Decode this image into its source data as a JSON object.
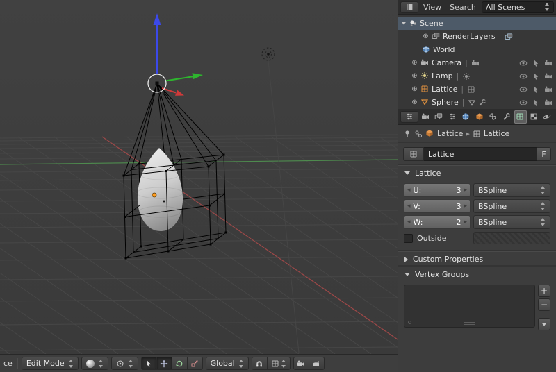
{
  "icons": {
    "expand_plus": "⊕",
    "pipe": "|",
    "num_left": "◂",
    "num_right": "▸",
    "crumb_sep": "▸",
    "plus": "+",
    "minus": "−"
  },
  "viewport": {
    "footer": {
      "crop_text": "ce",
      "mode": "Edit Mode",
      "orientation": "Global"
    }
  },
  "outliner": {
    "menus": {
      "view": "View",
      "search": "Search",
      "all_scenes": "All Scenes"
    },
    "rows": [
      {
        "label": "Scene"
      },
      {
        "label": "RenderLayers"
      },
      {
        "label": "World"
      },
      {
        "label": "Camera"
      },
      {
        "label": "Lamp"
      },
      {
        "label": "Lattice"
      },
      {
        "label": "Sphere"
      }
    ]
  },
  "properties": {
    "breadcrumb": {
      "object_name": "Lattice",
      "data_name": "Lattice"
    },
    "name_field": {
      "value": "Lattice",
      "fake_user": "F"
    },
    "lattice": {
      "title": "Lattice",
      "u_label": "U:",
      "u_value": "3",
      "v_label": "V:",
      "v_value": "3",
      "w_label": "W:",
      "w_value": "2",
      "interpolation_u": "BSpline",
      "interpolation_v": "BSpline",
      "interpolation_w": "BSpline",
      "outside_label": "Outside"
    },
    "custom_properties": {
      "title": "Custom Properties"
    },
    "vertex_groups": {
      "title": "Vertex Groups"
    }
  }
}
